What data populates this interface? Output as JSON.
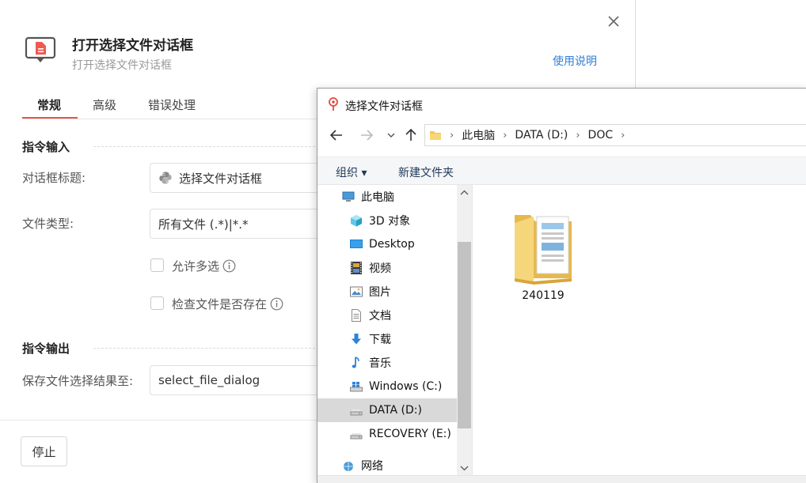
{
  "dialog": {
    "title": "打开选择文件对话框",
    "subtitle": "打开选择文件对话框",
    "help_link": "使用说明",
    "tabs": [
      {
        "label": "常规"
      },
      {
        "label": "高级"
      },
      {
        "label": "错误处理"
      }
    ],
    "sections": {
      "input": "指令输入",
      "output": "指令输出"
    },
    "fields": {
      "dialog_title_label": "对话框标题:",
      "dialog_title_value": "选择文件对话框",
      "file_type_label": "文件类型:",
      "file_type_value": "所有文件 (.*)|*.*",
      "allow_multi_label": "允许多选",
      "check_exists_label": "检查文件是否存在",
      "save_result_label": "保存文件选择结果至:",
      "save_result_value": "select_file_dialog"
    },
    "stop_button": "停止",
    "accent_color": "#e8534a",
    "link_color": "#2f7fd6"
  },
  "file_dialog": {
    "title": "选择文件对话框",
    "address": [
      "此电脑",
      "DATA (D:)",
      "DOC"
    ],
    "toolbar": {
      "organize": "组织 ▾",
      "new_folder": "新建文件夹"
    },
    "tree": [
      {
        "label": "此电脑",
        "icon": "computer-icon"
      },
      {
        "label": "3D 对象",
        "icon": "cube-icon"
      },
      {
        "label": "Desktop",
        "icon": "desktop-icon"
      },
      {
        "label": "视频",
        "icon": "film-icon"
      },
      {
        "label": "图片",
        "icon": "picture-icon"
      },
      {
        "label": "文档",
        "icon": "document-icon"
      },
      {
        "label": "下载",
        "icon": "download-icon"
      },
      {
        "label": "音乐",
        "icon": "music-icon"
      },
      {
        "label": "Windows (C:)",
        "icon": "windows-drive-icon"
      },
      {
        "label": "DATA (D:)",
        "icon": "drive-icon",
        "selected": true
      },
      {
        "label": "RECOVERY (E:)",
        "icon": "drive-icon"
      },
      {
        "label": "网络",
        "icon": "network-icon"
      }
    ],
    "files": [
      {
        "name": "240119",
        "icon": "folder-icon"
      }
    ]
  }
}
